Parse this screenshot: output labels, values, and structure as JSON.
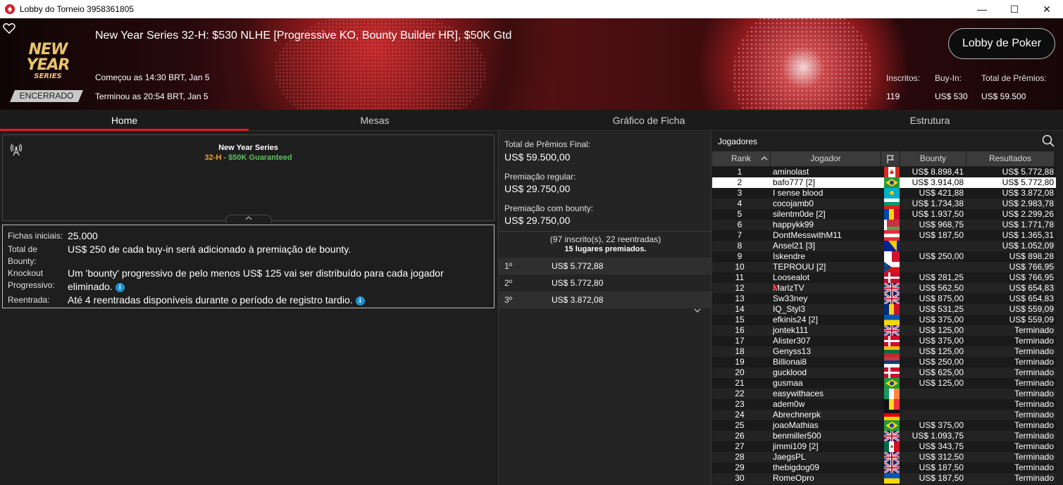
{
  "window": {
    "title": "Lobby do Torneio 3958361805",
    "minimize": "—",
    "maximize": "☐",
    "close": "✕"
  },
  "banner": {
    "logo_line1": "NEW YEAR",
    "logo_line2": "SERIES",
    "event_title": "New Year Series 32-H: $530 NLHE [Progressive KO, Bounty Builder HR], $50K Gtd",
    "started": "Começou as 14:30 BRT, Jan 5",
    "ended": "Terminou as 20:54 BRT, Jan 5",
    "status": "ENCERRADO",
    "lobby_button": "Lobby de Poker",
    "stats": {
      "entrants_label": "Inscritos:",
      "entrants_value": "119",
      "buyin_label": "Buy-In:",
      "buyin_value": "US$ 530",
      "prize_label": "Total de Prêmios:",
      "prize_value": "US$ 59.500"
    }
  },
  "tabs": [
    "Home",
    "Mesas",
    "Gráfico de Ficha",
    "Estrutura"
  ],
  "series": {
    "name": "New Year Series",
    "event_number": "32-H",
    "separator": " - ",
    "guarantee": "$50K Guaranteed"
  },
  "info": {
    "starting_chips_label": "Fichas iniciais:",
    "starting_chips_value": "25.000",
    "bounty_label": "Total de Bounty:",
    "bounty_value": "US$ 250 de cada buy-in será adicionado à premiação de bounty.",
    "pko_label": "Knockout Progressivo:",
    "pko_value": "Um 'bounty' progressivo de pelo menos US$ 125 vai ser distribuído para cada jogador eliminado.",
    "reentry_label": "Reentrada:",
    "reentry_value": "Até 4 reentradas disponíveis durante o período de registro tardio."
  },
  "prizes": {
    "final_label": "Total de Prêmios Final:",
    "final_value": "US$ 59.500,00",
    "regular_label": "Premiação regular:",
    "regular_value": "US$ 29.750,00",
    "bounty_label": "Premiação com bounty:",
    "bounty_value": "US$ 29.750,00",
    "entrants_note": "(97 inscrito(s), 22 reentradas)",
    "paid_note": "15 lugares premiados.",
    "payouts": [
      {
        "pos": "1º",
        "amount": "US$ 5.772,88"
      },
      {
        "pos": "2º",
        "amount": "US$ 5.772,80"
      },
      {
        "pos": "3º",
        "amount": "US$ 3.872,08"
      }
    ]
  },
  "players": {
    "header": "Jogadores",
    "columns": {
      "rank": "Rank",
      "player": "Jogador",
      "bounty": "Bounty",
      "results": "Resultados"
    },
    "rows": [
      {
        "rank": "1",
        "name": "aminolast",
        "flag": "ca",
        "bounty": "US$ 8.898,41",
        "result": "US$ 5.772,88"
      },
      {
        "rank": "2",
        "name": "bafo777 [2]",
        "flag": "br",
        "bounty": "US$ 3.914,08",
        "result": "US$ 5.772,80"
      },
      {
        "rank": "3",
        "name": "I sense blood",
        "flag": "kz",
        "bounty": "US$ 421,88",
        "result": "US$ 3.872,08"
      },
      {
        "rank": "4",
        "name": "cocojamb0",
        "flag": "bg",
        "bounty": "US$ 1.734,38",
        "result": "US$ 2.983,78"
      },
      {
        "rank": "5",
        "name": "silentm0de [2]",
        "flag": "md",
        "bounty": "US$ 1.937,50",
        "result": "US$ 2.299,26"
      },
      {
        "rank": "6",
        "name": "happykk99",
        "flag": "by",
        "bounty": "US$ 968,75",
        "result": "US$ 1.771,78"
      },
      {
        "rank": "7",
        "name": "DontMesswithM11",
        "flag": "at",
        "bounty": "US$ 187,50",
        "result": "US$ 1.365,31"
      },
      {
        "rank": "8",
        "name": "Ansel21 [3]",
        "flag": "ba",
        "bounty": "",
        "result": "US$ 1.052,09"
      },
      {
        "rank": "9",
        "name": "Iskendre",
        "flag": "mt",
        "bounty": "US$ 250,00",
        "result": "US$ 898,28"
      },
      {
        "rank": "10",
        "name": "TEPROUU [2]",
        "flag": "cz",
        "bounty": "",
        "result": "US$ 766,95"
      },
      {
        "rank": "11",
        "name": "Loosealot",
        "flag": "dk",
        "bounty": "US$ 281,25",
        "result": "US$ 766,95"
      },
      {
        "rank": "12",
        "name": "MarlzTV",
        "flag": "gb",
        "bounty": "US$ 562,50",
        "result": "US$ 654,83",
        "pro": true
      },
      {
        "rank": "13",
        "name": "Sw33ney",
        "flag": "gb",
        "bounty": "US$ 875,00",
        "result": "US$ 654,83"
      },
      {
        "rank": "14",
        "name": "IQ_Styl3",
        "flag": "ro",
        "bounty": "US$ 531,25",
        "result": "US$ 559,09"
      },
      {
        "rank": "15",
        "name": "efkinis24 [2]",
        "flag": "ua",
        "bounty": "US$ 375,00",
        "result": "US$ 559,09"
      },
      {
        "rank": "16",
        "name": "jontek111",
        "flag": "gb",
        "bounty": "US$ 125,00",
        "result": "Terminado"
      },
      {
        "rank": "17",
        "name": "Alister307",
        "flag": "dk",
        "bounty": "US$ 375,00",
        "result": "Terminado"
      },
      {
        "rank": "18",
        "name": "Genyss13",
        "flag": "lt",
        "bounty": "US$ 125,00",
        "result": "Terminado"
      },
      {
        "rank": "19",
        "name": "Billionai8",
        "flag": "rs",
        "bounty": "US$ 250,00",
        "result": "Terminado"
      },
      {
        "rank": "20",
        "name": "gucklood",
        "flag": "dk",
        "bounty": "US$ 625,00",
        "result": "Terminado"
      },
      {
        "rank": "21",
        "name": "gusmaa",
        "flag": "br",
        "bounty": "US$ 125,00",
        "result": "Terminado"
      },
      {
        "rank": "22",
        "name": "easywithaces",
        "flag": "ie",
        "bounty": "",
        "result": "Terminado"
      },
      {
        "rank": "23",
        "name": "adem0w",
        "flag": "be",
        "bounty": "",
        "result": "Terminado"
      },
      {
        "rank": "24",
        "name": "Abrechnerpk",
        "flag": "de",
        "bounty": "",
        "result": "Terminado"
      },
      {
        "rank": "25",
        "name": "joaoMathias",
        "flag": "br",
        "bounty": "US$ 375,00",
        "result": "Terminado"
      },
      {
        "rank": "26",
        "name": "benmiller500",
        "flag": "gb",
        "bounty": "US$ 1.093,75",
        "result": "Terminado"
      },
      {
        "rank": "27",
        "name": "jimmi109 [2]",
        "flag": "mx",
        "bounty": "US$ 343,75",
        "result": "Terminado"
      },
      {
        "rank": "28",
        "name": "JaegsPL",
        "flag": "gb",
        "bounty": "US$ 312,50",
        "result": "Terminado"
      },
      {
        "rank": "29",
        "name": "thebigdog09",
        "flag": "gb",
        "bounty": "US$ 187,50",
        "result": "Terminado"
      },
      {
        "rank": "30",
        "name": "RomeOpro",
        "flag": "ua",
        "bounty": "US$ 187,50",
        "result": "Terminado"
      }
    ],
    "selected_rank": "2"
  },
  "colors": {
    "accent": "#e01b24",
    "info_icon": "#1c93d1",
    "event_orange": "#f0a030",
    "guarantee_green": "#5cc05c"
  },
  "icons": [
    "pokerstars-spade-icon",
    "heart-icon",
    "antenna-icon",
    "chevron-up-icon",
    "chevron-down-icon",
    "search-icon",
    "sort-up-icon",
    "flag-column-icon",
    "info-icon"
  ]
}
